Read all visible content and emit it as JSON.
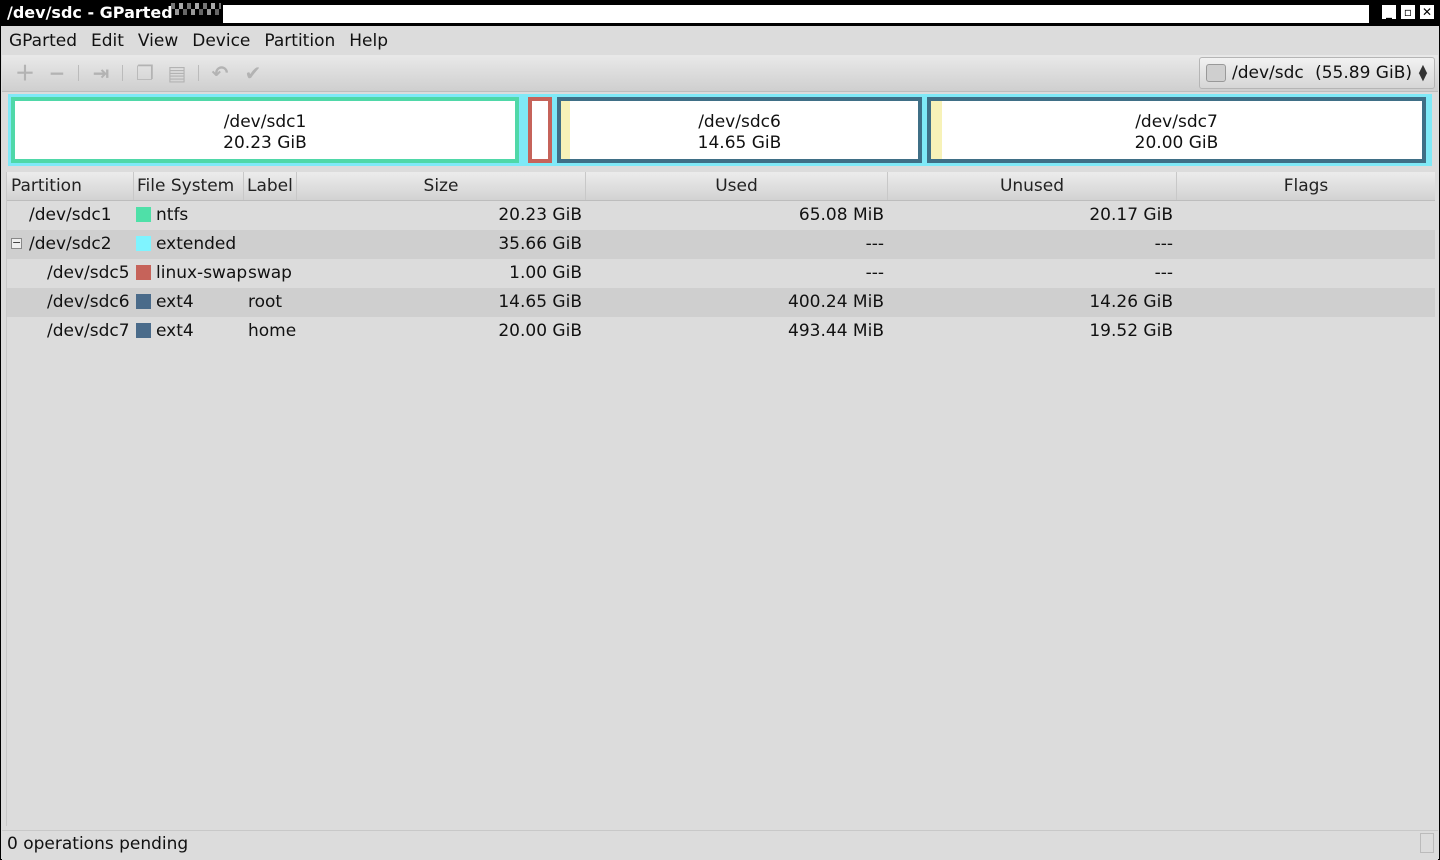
{
  "window": {
    "title": "/dev/sdc - GParted"
  },
  "menu": [
    "GParted",
    "Edit",
    "View",
    "Device",
    "Partition",
    "Help"
  ],
  "toolbar": {
    "device_name": "/dev/sdc",
    "device_size": "(55.89 GiB)"
  },
  "map": {
    "sdc1": {
      "name": "/dev/sdc1",
      "size": "20.23 GiB"
    },
    "sdc6": {
      "name": "/dev/sdc6",
      "size": "14.65 GiB"
    },
    "sdc7": {
      "name": "/dev/sdc7",
      "size": "20.00 GiB"
    }
  },
  "columns": [
    "Partition",
    "File System",
    "Label",
    "Size",
    "Used",
    "Unused",
    "Flags"
  ],
  "rows": [
    {
      "partition": "/dev/sdc1",
      "fs": "ntfs",
      "fs_color": "#4fe0a8",
      "label": "",
      "size": "20.23 GiB",
      "used": "65.08 MiB",
      "unused": "20.17 GiB",
      "flags": ""
    },
    {
      "partition": "/dev/sdc2",
      "fs": "extended",
      "fs_color": "#7ff4ff",
      "label": "",
      "size": "35.66 GiB",
      "used": "---",
      "unused": "---",
      "flags": ""
    },
    {
      "partition": "/dev/sdc5",
      "fs": "linux-swap",
      "fs_color": "#c6635a",
      "label": "swap",
      "size": "1.00 GiB",
      "used": "---",
      "unused": "---",
      "flags": ""
    },
    {
      "partition": "/dev/sdc6",
      "fs": "ext4",
      "fs_color": "#4a6b8a",
      "label": "root",
      "size": "14.65 GiB",
      "used": "400.24 MiB",
      "unused": "14.26 GiB",
      "flags": ""
    },
    {
      "partition": "/dev/sdc7",
      "fs": "ext4",
      "fs_color": "#4a6b8a",
      "label": "home",
      "size": "20.00 GiB",
      "used": "493.44 MiB",
      "unused": "19.52 GiB",
      "flags": ""
    }
  ],
  "status": {
    "text": "0 operations pending"
  }
}
